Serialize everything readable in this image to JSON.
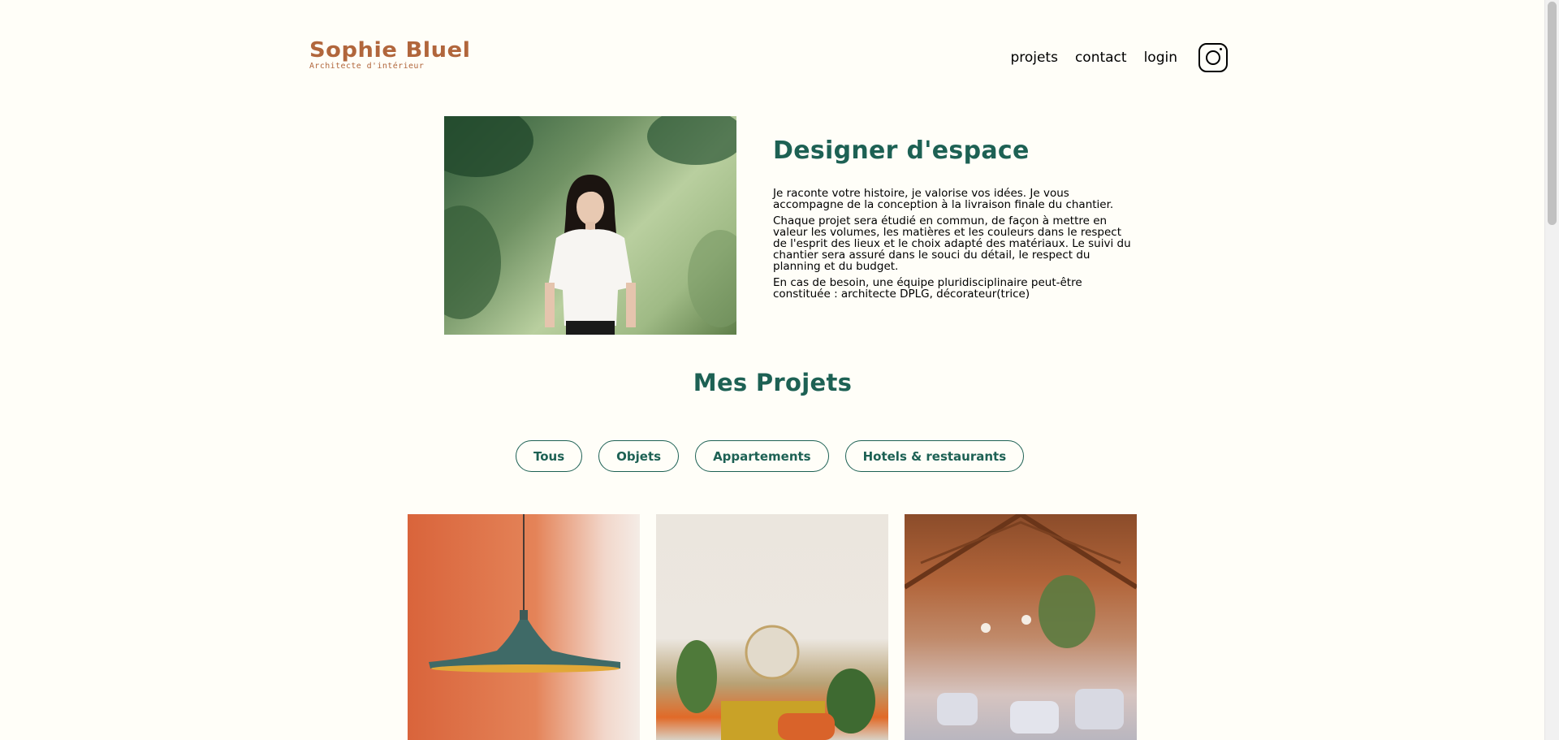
{
  "header": {
    "logo_name": "Sophie Bluel",
    "logo_subtitle": "Architecte d'intérieur",
    "nav": [
      "projets",
      "contact",
      "login"
    ]
  },
  "intro": {
    "title": "Designer d'espace",
    "paragraphs": [
      "Je raconte votre histoire, je valorise vos idées. Je vous accompagne de la conception à la livraison finale du chantier.",
      "Chaque projet sera étudié en commun, de façon à mettre en valeur les volumes, les matières et les couleurs dans le respect de l'esprit des lieux et le choix adapté des matériaux. Le suivi du chantier sera assuré dans le souci du détail, le respect du planning et du budget.",
      "En cas de besoin, une équipe pluridisciplinaire peut-être constituée : architecte DPLG, décorateur(trice)"
    ]
  },
  "portfolio": {
    "title": "Mes Projets",
    "filters": [
      "Tous",
      "Objets",
      "Appartements",
      "Hotels & restaurants"
    ]
  },
  "colors": {
    "accent": "#1D6154",
    "brand": "#B1663C",
    "background": "#FFFEF8"
  },
  "icons": {
    "social": "instagram-icon"
  }
}
